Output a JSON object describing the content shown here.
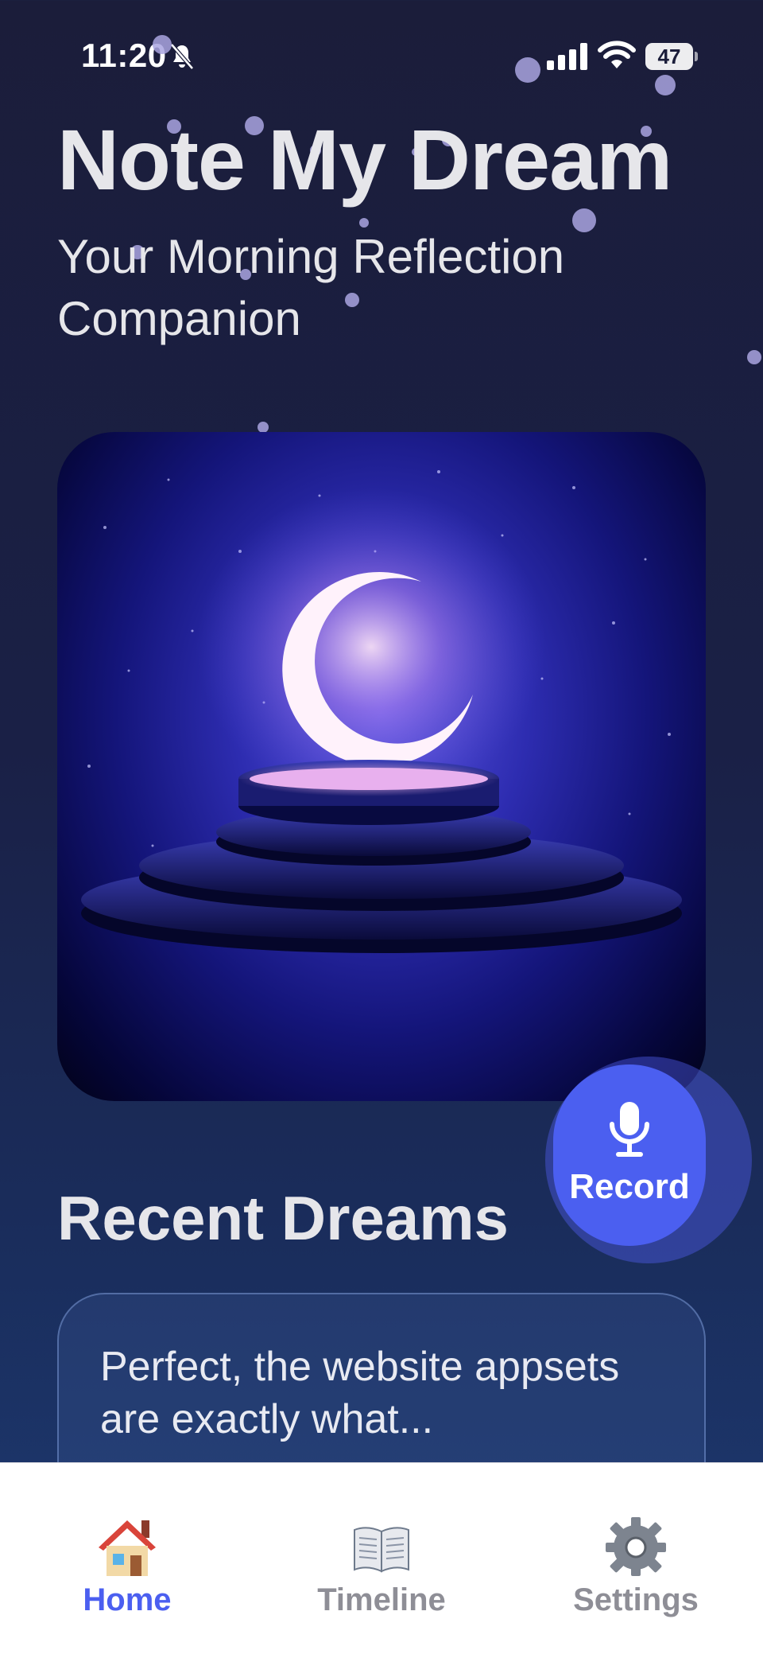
{
  "status_bar": {
    "time": "11:20",
    "battery": "47"
  },
  "header": {
    "title": "Note My Dream",
    "subtitle": "Your Morning Reflection Companion"
  },
  "hero": {
    "icon": "crescent-moon-on-pedestal"
  },
  "record_button": {
    "label": "Record",
    "icon": "microphone-icon"
  },
  "recent": {
    "title": "Recent Dreams",
    "items": [
      {
        "text": "Perfect, the website appsets are exactly what..."
      }
    ]
  },
  "tab_bar": {
    "active": "Home",
    "tabs": [
      {
        "label": "Home",
        "icon": "house-icon",
        "color": "#4b5ff0"
      },
      {
        "label": "Timeline",
        "icon": "book-icon",
        "color": "#8e8e96"
      },
      {
        "label": "Settings",
        "icon": "gear-icon",
        "color": "#8e8e96"
      }
    ]
  },
  "colors": {
    "accent": "#4b5ff0",
    "background_top": "#1b1d3a",
    "background_bottom": "#1d3a72"
  }
}
